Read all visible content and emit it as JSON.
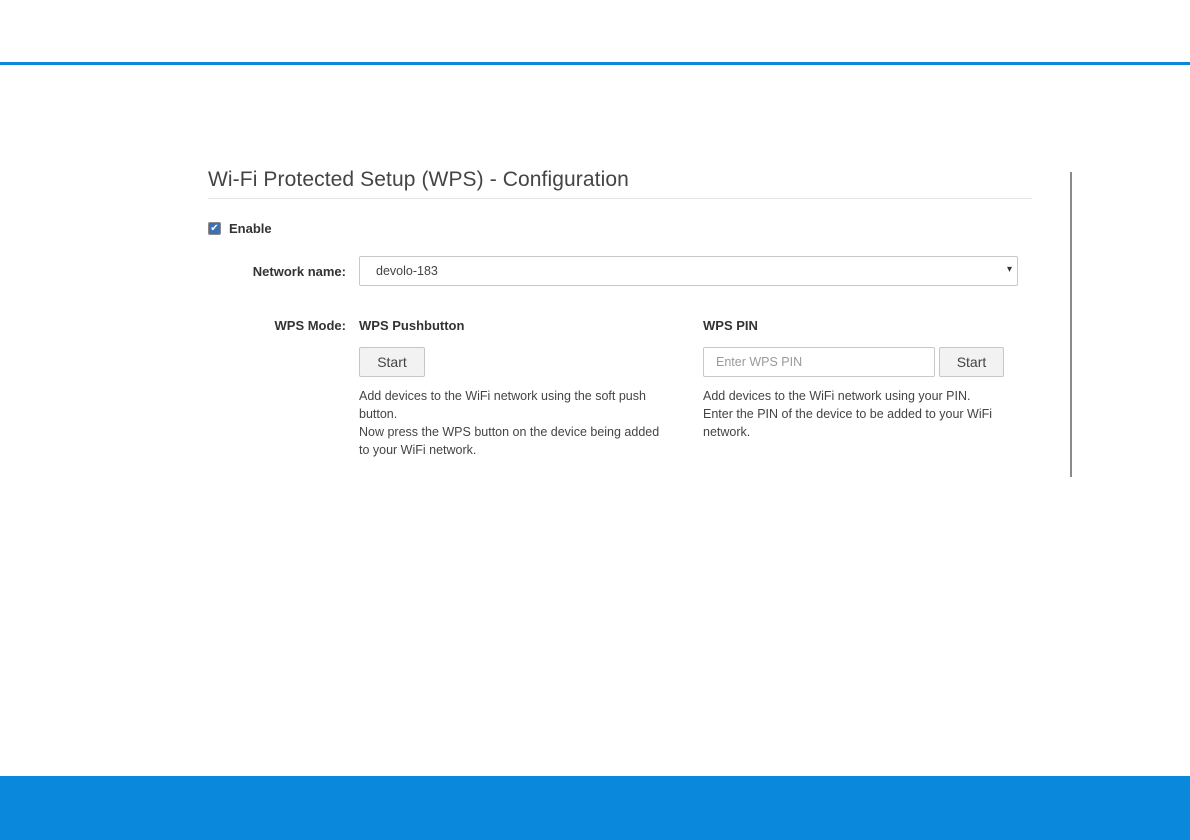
{
  "colors": {
    "accent": "#0a88dc",
    "text": "#333333",
    "checkbox_fill": "#3d6fb3"
  },
  "page": {
    "title": "Wi-Fi Protected Setup (WPS) - Configuration"
  },
  "enable": {
    "label": "Enable",
    "checked": true,
    "check_glyph": "✔"
  },
  "network": {
    "label": "Network name:",
    "selected_value": "devolo-183",
    "arrow_glyph": "▾",
    "icon": "chevron-down-icon"
  },
  "wps_mode": {
    "label": "WPS Mode:",
    "pushbutton": {
      "heading": "WPS Pushbutton",
      "button_label": "Start",
      "description_lines": [
        "Add devices to the WiFi network using the soft push",
        "button.",
        "Now press the WPS button on the device being added",
        "to your WiFi network."
      ]
    },
    "pin": {
      "heading": "WPS PIN",
      "input_value": "",
      "input_placeholder": "Enter WPS PIN",
      "button_label": "Start",
      "description_lines": [
        "Add devices to the WiFi network using your PIN.",
        "Enter the PIN of the device to be added to your WiFi",
        "network."
      ]
    }
  }
}
